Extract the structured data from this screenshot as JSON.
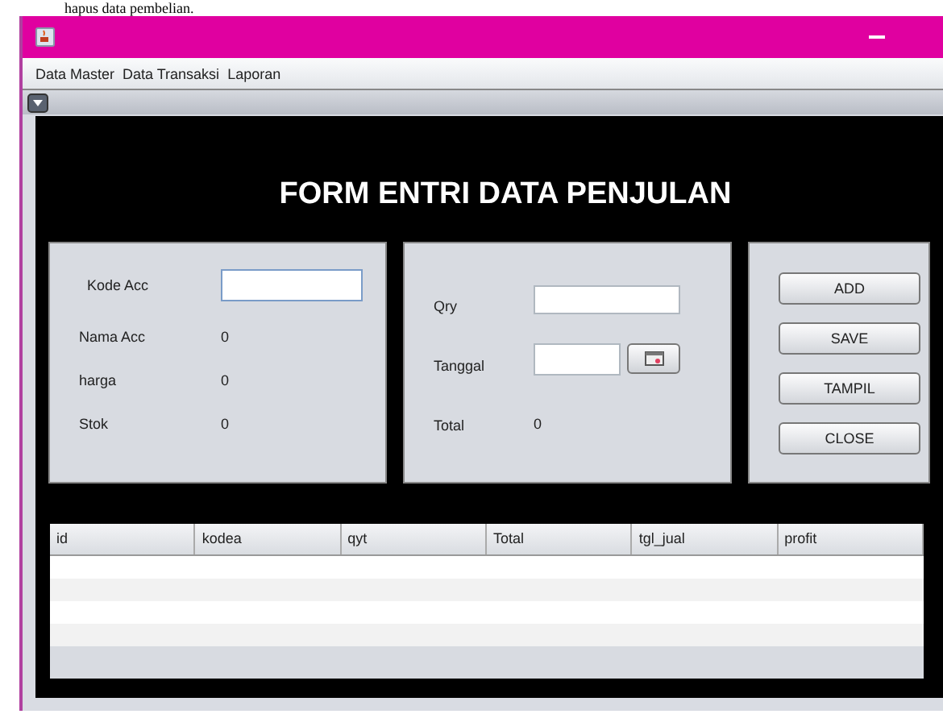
{
  "document_text": "hapus data pembelian.",
  "menu": [
    "Data Master",
    "Data Transaksi",
    "Laporan"
  ],
  "form_title": "FORM ENTRI DATA PENJULAN",
  "left_panel": [
    {
      "label": "Kode Acc",
      "kind": "input"
    },
    {
      "label": "Nama Acc",
      "kind": "value",
      "value": "0"
    },
    {
      "label": "harga",
      "kind": "value",
      "value": "0"
    },
    {
      "label": "Stok",
      "kind": "value",
      "value": "0"
    }
  ],
  "middle_panel": [
    {
      "label": "Qry",
      "kind": "input"
    },
    {
      "label": "Tanggal",
      "kind": "date"
    },
    {
      "label": "Total",
      "kind": "value",
      "value": "0"
    }
  ],
  "buttons": [
    "ADD",
    "SAVE",
    "TAMPIL",
    "CLOSE"
  ],
  "table": {
    "columns": [
      "id",
      "kodea",
      "qyt",
      "Total",
      "tgl_jual",
      "profit"
    ]
  }
}
